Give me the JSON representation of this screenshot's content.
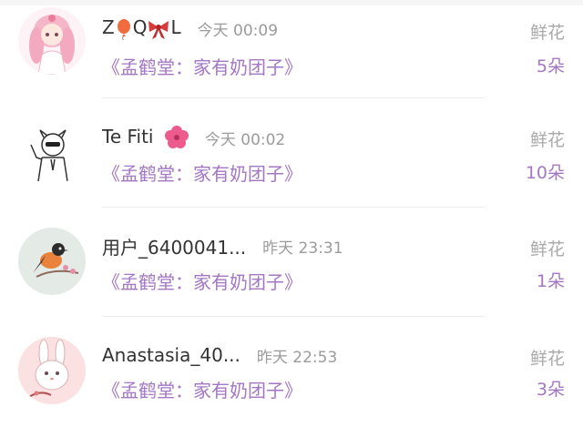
{
  "rows": [
    {
      "username_parts": [
        "Z",
        "Q",
        "L"
      ],
      "time": "今天 00:09",
      "book": "《孟鹤堂：家有奶团子》",
      "gift_label": "鲜花",
      "gift_count": "5朵",
      "avatar_icon": "anime-girl-avatar-icon"
    },
    {
      "username": "Te Fiti",
      "time": "今天 00:02",
      "book": "《孟鹤堂：家有奶团子》",
      "gift_label": "鲜花",
      "gift_count": "10朵",
      "avatar_icon": "sketch-man-avatar-icon"
    },
    {
      "username": "用户_6400041...",
      "time": "昨天 23:31",
      "book": "《孟鹤堂：家有奶团子》",
      "gift_label": "鲜花",
      "gift_count": "1朵",
      "avatar_icon": "bird-avatar-icon"
    },
    {
      "username": "Anastasia_40...",
      "time": "昨天 22:53",
      "book": "《孟鹤堂：家有奶团子》",
      "gift_label": "鲜花",
      "gift_count": "3朵",
      "avatar_icon": "bunny-avatar-icon"
    }
  ],
  "colors": {
    "accent_purple": "#a477c4",
    "gray_text": "#9b9b9b",
    "name_text": "#333333"
  }
}
